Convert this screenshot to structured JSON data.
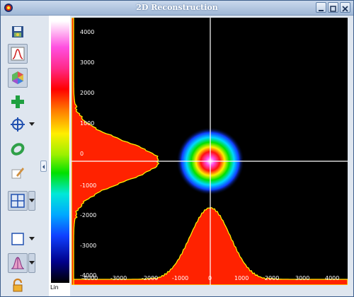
{
  "window": {
    "title": "2D Reconstruction",
    "controls": [
      "minimize",
      "maximize",
      "close"
    ]
  },
  "toolbar": {
    "buttons": [
      {
        "name": "save-image-icon"
      },
      {
        "name": "profile-chart-icon",
        "pressed": true
      },
      {
        "name": "color-palette-icon",
        "pressed": true
      },
      {
        "name": "add-icon"
      },
      {
        "name": "crosshair-icon",
        "has_dropdown": true
      },
      {
        "name": "ellipse-fit-icon"
      },
      {
        "name": "edit-image-icon"
      },
      {
        "name": "grid-view-icon",
        "pressed": true,
        "has_dropdown": true
      },
      {
        "name": "rectangle-roi-icon",
        "has_dropdown": true
      },
      {
        "name": "gaussian-fit-icon",
        "pressed": true,
        "has_dropdown": true
      },
      {
        "name": "lock-icon"
      }
    ]
  },
  "colorbar": {
    "scale_label": "Lin"
  },
  "plot": {
    "y_ticks": [
      "4000",
      "3000",
      "2000",
      "1000",
      "0",
      "-1000",
      "-2000",
      "-3000",
      "-4000"
    ],
    "x_ticks": [
      "-4000",
      "-3000",
      "-2000",
      "-1000",
      "0",
      "1000",
      "2000",
      "3000",
      "4000"
    ],
    "crosshair": {
      "x": 0,
      "y": -200
    },
    "beam_center": {
      "x": 0,
      "y": -200
    }
  },
  "colors": {
    "background": "#000000",
    "crosshair": "#ffffff",
    "profile_fill": "#ff2200",
    "profile_outline": "#ffee00"
  }
}
